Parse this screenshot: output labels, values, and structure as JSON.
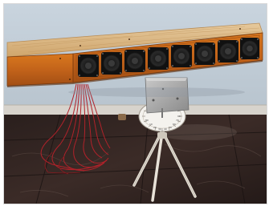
{
  "image": {
    "protractor_numbers": [
      "10",
      "20",
      "30",
      "40",
      "50",
      "60",
      "70",
      "80",
      "90"
    ]
  }
}
